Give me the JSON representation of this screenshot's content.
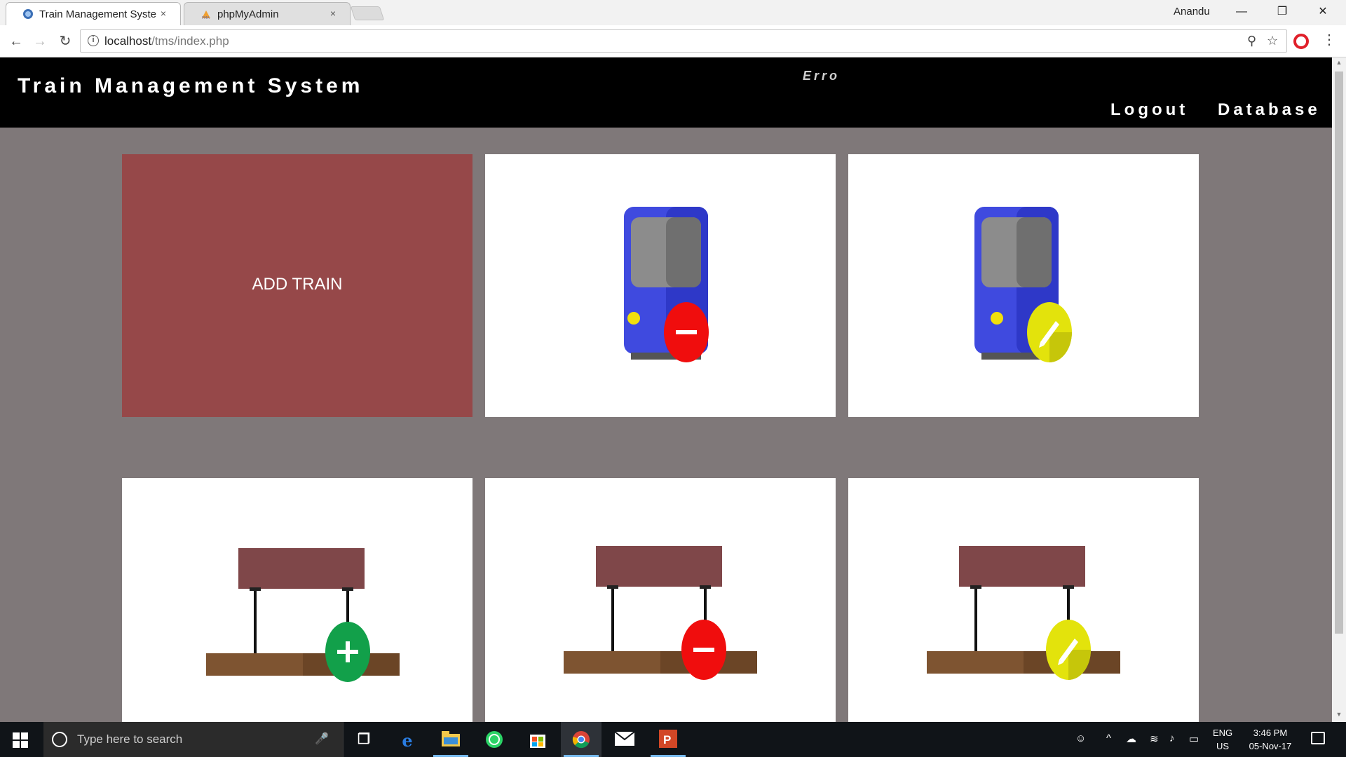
{
  "browser": {
    "tabs": [
      {
        "title": "Train Management Syste",
        "active": true
      },
      {
        "title": "phpMyAdmin",
        "active": false
      }
    ],
    "tab_close": "×",
    "profile_name": "Anandu",
    "window_controls": {
      "minimize": "—",
      "restore": "❐",
      "close": "✕"
    },
    "nav": {
      "back": "←",
      "forward": "→",
      "reload": "↻"
    },
    "url_host": "localhost",
    "url_path": "/tms/index.php",
    "menu": "⋮",
    "key_icon": "⚲",
    "star_icon": "☆",
    "info_icon": "i"
  },
  "site": {
    "title": "Train Management System",
    "error_text": "Erro",
    "nav": {
      "logout": "Logout",
      "database": "Database"
    },
    "cards": [
      {
        "id": "add-train",
        "label": "ADD TRAIN",
        "icon": "train-add-card"
      },
      {
        "id": "delete-train",
        "icon": "train-delete-icon"
      },
      {
        "id": "edit-train",
        "icon": "train-edit-icon"
      },
      {
        "id": "add-station",
        "icon": "station-add-icon"
      },
      {
        "id": "delete-station",
        "icon": "station-delete-icon"
      },
      {
        "id": "edit-station",
        "icon": "station-edit-icon"
      }
    ],
    "colors": {
      "page_bg": "#7f7879",
      "header_bg": "#000000",
      "add_card": "#964849",
      "train_body": "#4a55e8",
      "train_window": "#8c8c8c",
      "delete_badge": "#f01010",
      "edit_badge": "#e0e010",
      "add_badge": "#12a04a",
      "station_sign": "#7f4749",
      "station_platform": "#7e5431"
    }
  },
  "taskbar": {
    "search_placeholder": "Type here to search",
    "apps": [
      "task-view",
      "edge",
      "file-explorer",
      "whatsapp",
      "store",
      "chrome",
      "mail",
      "powerpoint"
    ],
    "lang_top": "ENG",
    "lang_bottom": "US",
    "time": "3:46 PM",
    "date": "05-Nov-17"
  }
}
